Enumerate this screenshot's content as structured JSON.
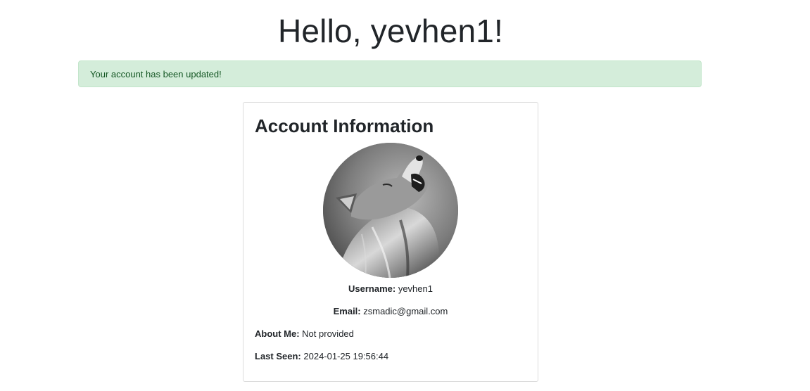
{
  "header": {
    "greeting": "Hello, yevhen1!"
  },
  "alert": {
    "message": "Your account has been updated!"
  },
  "account": {
    "title": "Account Information",
    "avatar_icon": "wolf-avatar-image",
    "username_label": "Username:",
    "username_value": "yevhen1",
    "email_label": "Email:",
    "email_value": "zsmadic@gmail.com",
    "about_label": "About Me:",
    "about_value": "Not provided",
    "last_seen_label": "Last Seen:",
    "last_seen_value": "2024-01-25 19:56:44"
  },
  "colors": {
    "alert_bg": "#d4edda",
    "alert_text": "#155724",
    "card_border": "#dcdcdc"
  }
}
